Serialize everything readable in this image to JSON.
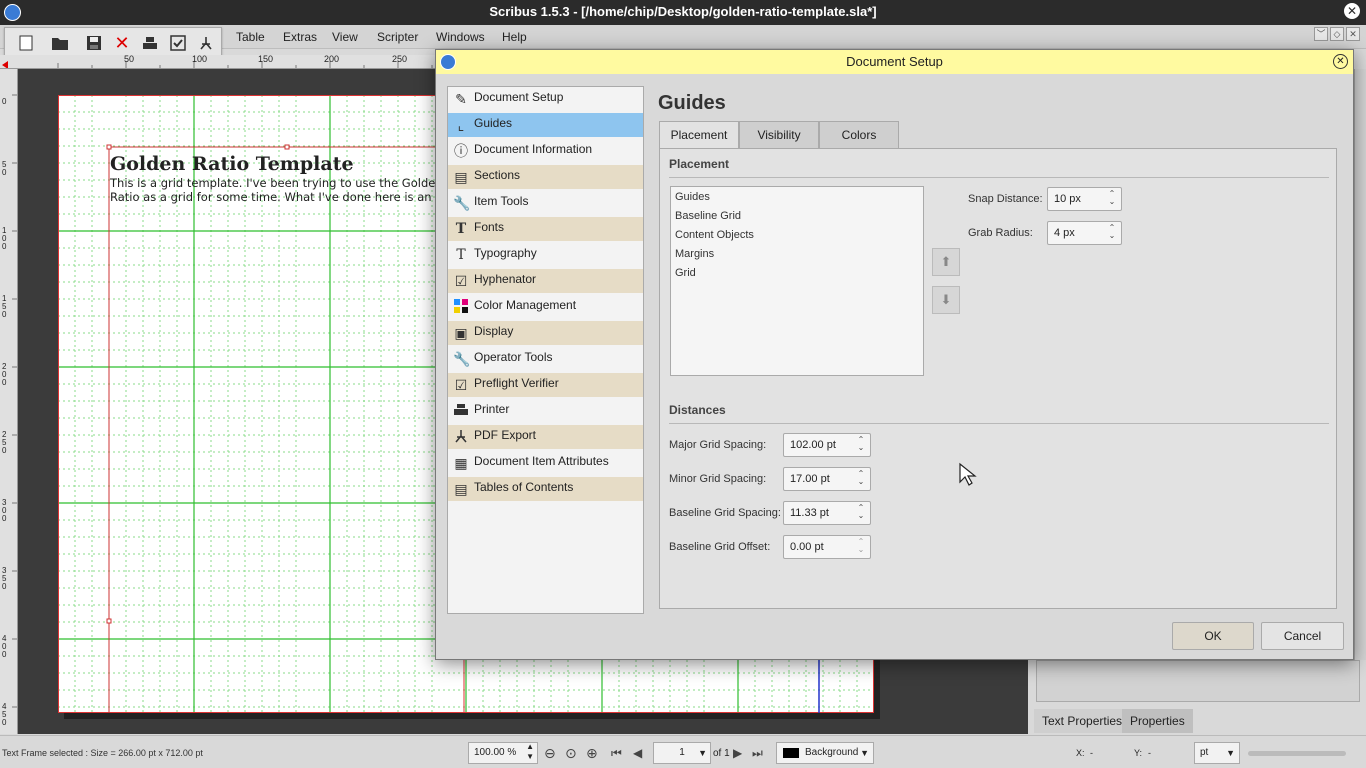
{
  "window": {
    "title": "Scribus 1.5.3 - [/home/chip/Desktop/golden-ratio-template.sla*]",
    "close_icon": "close-icon"
  },
  "menubar": {
    "items": [
      "Table",
      "Extras",
      "View",
      "Scripter",
      "Windows",
      "Help"
    ]
  },
  "toolbar": {
    "icons": [
      "new-document-icon",
      "open-icon",
      "save-icon",
      "close-document-icon",
      "print-icon",
      "preflight-icon",
      "pdf-export-icon"
    ]
  },
  "ruler": {
    "top_ticks": [
      "50",
      "100",
      "150",
      "200",
      "250"
    ],
    "left_ticks": [
      "0",
      "50",
      "100",
      "150",
      "200",
      "250",
      "300",
      "350",
      "400",
      "450"
    ]
  },
  "document": {
    "title": "Golden Ratio Template",
    "body_line1": "This is a grid template. I've been trying to use the Golde",
    "body_line2": "Ratio as a grid for some time. What I've done here is an"
  },
  "properties_panel": {
    "tabs": [
      "Text Properties",
      "Properties"
    ]
  },
  "statusbar": {
    "selection_text": "Text Frame selected : Size = 266.00 pt x 712.00 pt",
    "zoom": "100.00 %",
    "page_number": "1",
    "page_of": "of 1",
    "layer": "Background",
    "x_label": "X:",
    "x_value": "-",
    "y_label": "Y:",
    "y_value": "-",
    "unit": "pt"
  },
  "dialog": {
    "title": "Document Setup",
    "close_icon": "close-icon",
    "nav_items": [
      {
        "label": "Document Setup",
        "icon": "document-setup-icon"
      },
      {
        "label": "Guides",
        "icon": "guides-icon"
      },
      {
        "label": "Document Information",
        "icon": "info-icon"
      },
      {
        "label": "Sections",
        "icon": "sections-icon"
      },
      {
        "label": "Item Tools",
        "icon": "tools-icon"
      },
      {
        "label": "Fonts",
        "icon": "fonts-icon"
      },
      {
        "label": "Typography",
        "icon": "typography-icon"
      },
      {
        "label": "Hyphenator",
        "icon": "checkbox-icon"
      },
      {
        "label": "Color Management",
        "icon": "color-management-icon"
      },
      {
        "label": "Display",
        "icon": "display-icon"
      },
      {
        "label": "Operator Tools",
        "icon": "tools-icon"
      },
      {
        "label": "Preflight Verifier",
        "icon": "checkbox-icon"
      },
      {
        "label": "Printer",
        "icon": "printer-icon"
      },
      {
        "label": "PDF Export",
        "icon": "pdf-icon"
      },
      {
        "label": "Document Item Attributes",
        "icon": "attributes-icon"
      },
      {
        "label": "Tables of Contents",
        "icon": "toc-icon"
      }
    ],
    "selected_nav": "Guides",
    "heading": "Guides",
    "tabs": [
      "Placement",
      "Visibility",
      "Colors"
    ],
    "active_tab": "Placement",
    "placement": {
      "section_title": "Placement",
      "list_items": [
        "Guides",
        "Baseline Grid",
        "Content Objects",
        "Margins",
        "Grid"
      ],
      "snap_distance_label": "Snap Distance:",
      "snap_distance_value": "10 px",
      "grab_radius_label": "Grab Radius:",
      "grab_radius_value": "4 px",
      "move_up_icon": "arrow-up-icon",
      "move_down_icon": "arrow-down-icon"
    },
    "distances": {
      "section_title": "Distances",
      "major_label": "Major Grid Spacing:",
      "major_value": "102.00 pt",
      "minor_label": "Minor Grid Spacing:",
      "minor_value": "17.00 pt",
      "baseline_spacing_label": "Baseline Grid Spacing:",
      "baseline_spacing_value": "11.33 pt",
      "baseline_offset_label": "Baseline Grid Offset:",
      "baseline_offset_value": "0.00 pt"
    },
    "ok_label": "OK",
    "cancel_label": "Cancel"
  }
}
